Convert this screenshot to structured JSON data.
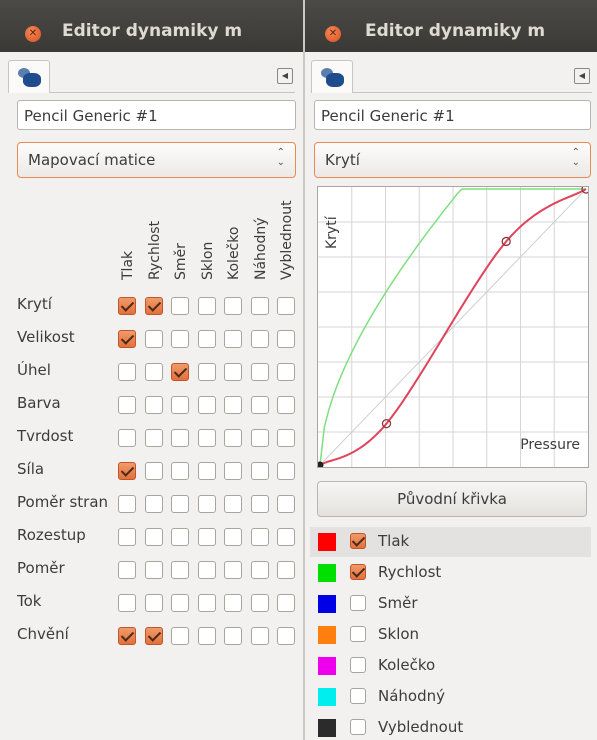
{
  "left": {
    "title": "Editor dynamiky m",
    "brush_name": "Pencil Generic #1",
    "mode": "Mapovací matice",
    "columns": [
      "Tlak",
      "Rychlost",
      "Směr",
      "Sklon",
      "Kolečko",
      "Náhodný",
      "Vyblednout"
    ],
    "rows": [
      {
        "label": "Krytí",
        "checks": [
          true,
          true,
          false,
          false,
          false,
          false,
          false
        ]
      },
      {
        "label": "Velikost",
        "checks": [
          true,
          false,
          false,
          false,
          false,
          false,
          false
        ]
      },
      {
        "label": "Úhel",
        "checks": [
          false,
          false,
          true,
          false,
          false,
          false,
          false
        ]
      },
      {
        "label": "Barva",
        "checks": [
          false,
          false,
          false,
          false,
          false,
          false,
          false
        ]
      },
      {
        "label": "Tvrdost",
        "checks": [
          false,
          false,
          false,
          false,
          false,
          false,
          false
        ]
      },
      {
        "label": "Síla",
        "checks": [
          true,
          false,
          false,
          false,
          false,
          false,
          false
        ]
      },
      {
        "label": "Poměr stran",
        "checks": [
          false,
          false,
          false,
          false,
          false,
          false,
          false
        ]
      },
      {
        "label": "Rozestup",
        "checks": [
          false,
          false,
          false,
          false,
          false,
          false,
          false
        ]
      },
      {
        "label": "Poměr",
        "checks": [
          false,
          false,
          false,
          false,
          false,
          false,
          false
        ]
      },
      {
        "label": "Tok",
        "checks": [
          false,
          false,
          false,
          false,
          false,
          false,
          false
        ]
      },
      {
        "label": "Chvění",
        "checks": [
          true,
          true,
          false,
          false,
          false,
          false,
          false
        ]
      }
    ]
  },
  "right": {
    "title": "Editor dynamiky m",
    "brush_name": "Pencil Generic #1",
    "mode": "Krytí",
    "curve": {
      "y_label": "Krytí",
      "x_label": "Pressure",
      "control_points": [
        [
          0,
          0
        ],
        [
          0.25,
          0.15
        ],
        [
          0.7,
          0.81
        ],
        [
          1,
          1
        ]
      ],
      "green_curve_color": "#7fe07f",
      "red_curve_color": "#e0435a"
    },
    "reset_label": "Původní křivka",
    "inputs": [
      {
        "label": "Tlak",
        "color": "#ff0000",
        "checked": true
      },
      {
        "label": "Rychlost",
        "color": "#00e000",
        "checked": true
      },
      {
        "label": "Směr",
        "color": "#0000e6",
        "checked": false
      },
      {
        "label": "Sklon",
        "color": "#ff7f0e",
        "checked": false
      },
      {
        "label": "Kolečko",
        "color": "#ee00ee",
        "checked": false
      },
      {
        "label": "Náhodný",
        "color": "#00eeee",
        "checked": false
      },
      {
        "label": "Vyblednout",
        "color": "#2b2b2b",
        "checked": false
      }
    ]
  }
}
